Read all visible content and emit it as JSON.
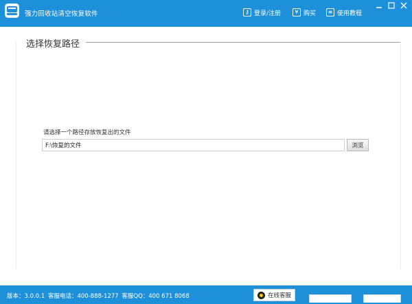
{
  "app": {
    "title": "强力回收站清空恢复软件"
  },
  "header_nav": {
    "login": "登录/注册",
    "buy": "购买",
    "tutorial": "使用教程"
  },
  "window_controls": {
    "minimize": "—",
    "maximize": "□",
    "close": "✕"
  },
  "section": {
    "title": "选择恢复路径"
  },
  "path_select": {
    "label": "请选择一个路径存放恢复出的文件",
    "value": "F:\\恢复的文件",
    "browse_label": "浏览"
  },
  "footer": {
    "version": "版本：3.0.0.1",
    "phone": "客服电话：400-888-1277",
    "qq": "客服QQ：400 671 8068",
    "service_button": "在线客服"
  },
  "colors": {
    "brand": "#1e8fd9"
  }
}
